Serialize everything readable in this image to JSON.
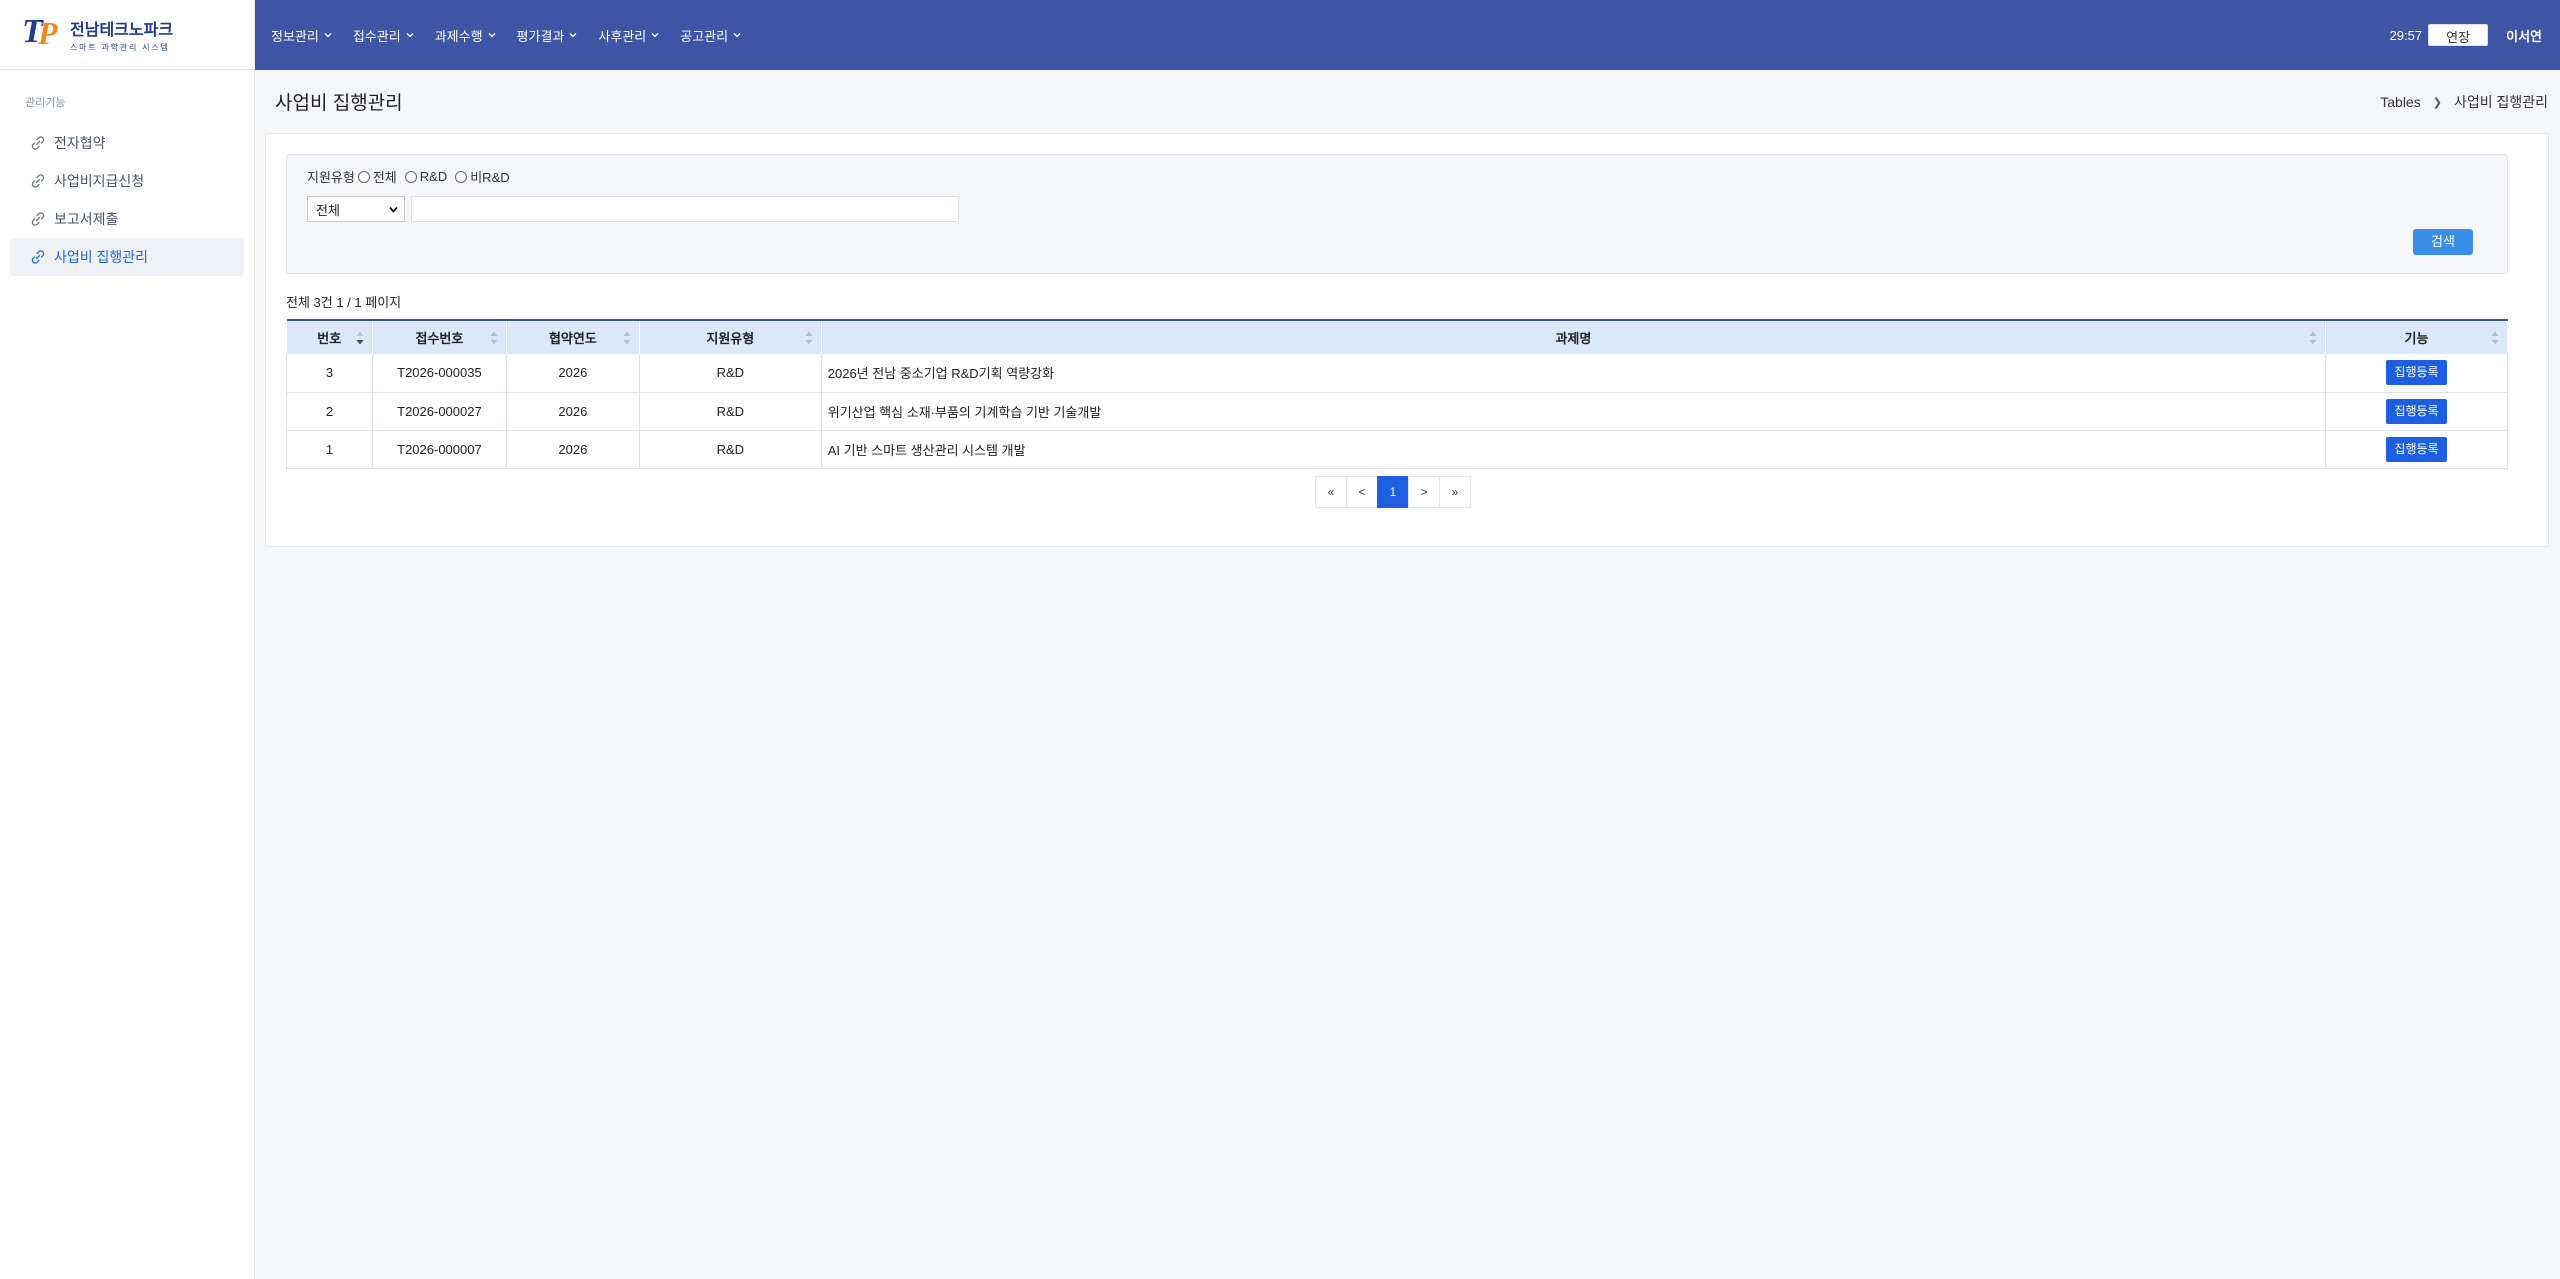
{
  "brand": {
    "title": "전남테크노파크",
    "subtitle": "스마트 과학관리 시스템"
  },
  "sidebar": {
    "section": "관리기능",
    "items": [
      {
        "label": "전자협약"
      },
      {
        "label": "사업비지급신청"
      },
      {
        "label": "보고서제출"
      },
      {
        "label": "사업비 집행관리"
      }
    ]
  },
  "topbar": {
    "menu": [
      {
        "label": "정보관리"
      },
      {
        "label": "접수관리"
      },
      {
        "label": "과제수행"
      },
      {
        "label": "평가결과"
      },
      {
        "label": "사후관리"
      },
      {
        "label": "공고관리"
      }
    ],
    "timer": "29:57",
    "extend_label": "연장",
    "user": "이서연"
  },
  "page": {
    "title": "사업비 집행관리",
    "breadcrumb": [
      "Tables",
      "사업비 집행관리"
    ]
  },
  "search": {
    "type_label": "지원유형",
    "radios": [
      "전체",
      "R&D",
      "비R&D"
    ],
    "select_value": "전체",
    "keyword_value": "",
    "button_label": "검색"
  },
  "summary": "전체 3건 1 / 1 페이지",
  "table": {
    "headers": [
      "번호",
      "접수번호",
      "협약연도",
      "지원유형",
      "과제명",
      "기능"
    ],
    "rows": [
      {
        "no": "3",
        "receipt": "T2026-000035",
        "year": "2026",
        "type": "R&D",
        "title": "2026년 전남 중소기업 R&D기획 역량강화",
        "action": "집행등록"
      },
      {
        "no": "2",
        "receipt": "T2026-000027",
        "year": "2026",
        "type": "R&D",
        "title": "위기산업 핵심 소재·부품의 기계학습 기반 기술개발",
        "action": "집행등록"
      },
      {
        "no": "1",
        "receipt": "T2026-000007",
        "year": "2026",
        "type": "R&D",
        "title": "AI 기반 스마트 생산관리 시스템 개발",
        "action": "집행등록"
      }
    ]
  },
  "pagination": {
    "first": "«",
    "prev": "<",
    "current": "1",
    "next": ">",
    "last": "»"
  },
  "colors": {
    "topbar": "#3e54a4",
    "primary_button": "#1d5fe0",
    "header_bg": "#dbe8fb",
    "search_button": "#3a8ee6"
  }
}
